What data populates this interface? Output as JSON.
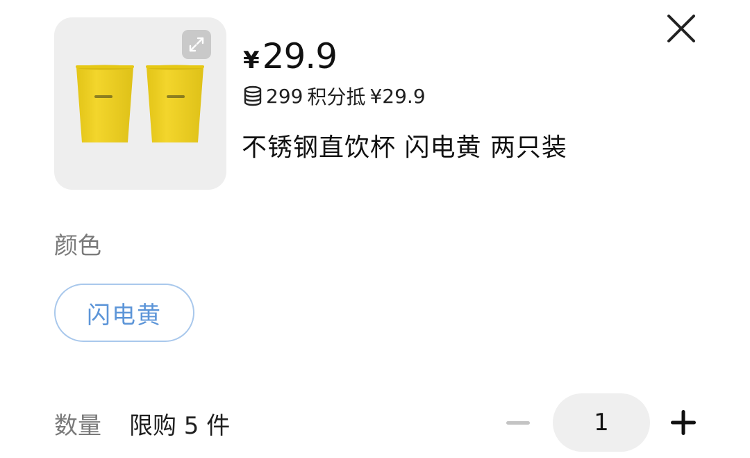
{
  "price": {
    "currency_symbol": "¥",
    "amount": "29.9"
  },
  "points": {
    "icon": "coin-stack-icon",
    "value": "299",
    "text": "积分抵",
    "deduct_amount": "¥29.9"
  },
  "product": {
    "title": "不锈钢直饮杯 闪电黄 两只装",
    "image_icon": "yellow-cups-image",
    "image_color": "#f2d21a"
  },
  "color_section": {
    "label": "颜色",
    "selected": "闪电黄",
    "accent": "#5c95d8"
  },
  "quantity_section": {
    "label": "数量",
    "limit_text": "限购 5 件",
    "value": "1",
    "minus_icon": "minus-icon",
    "plus_icon": "plus-icon"
  },
  "controls": {
    "close_icon": "close-icon",
    "expand_icon": "expand-icon"
  }
}
